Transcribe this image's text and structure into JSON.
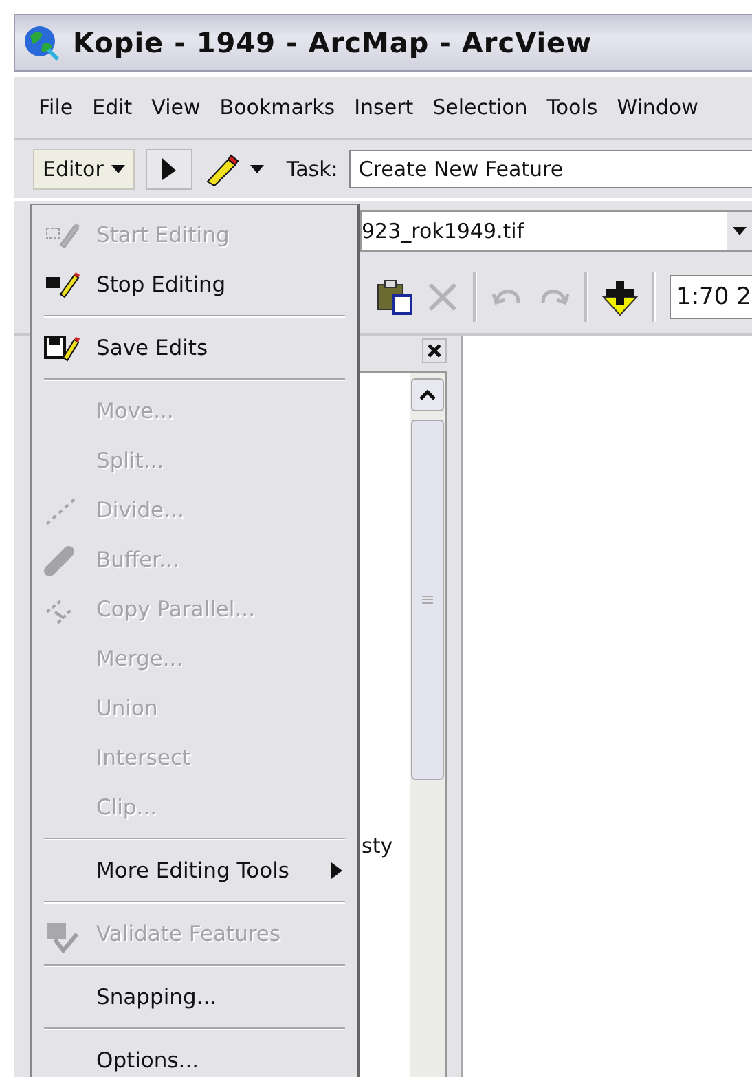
{
  "window": {
    "title": "Kopie - 1949 - ArcMap - ArcView"
  },
  "menu_bar": [
    "File",
    "Edit",
    "View",
    "Bookmarks",
    "Insert",
    "Selection",
    "Tools",
    "Window"
  ],
  "editor_toolbar": {
    "editor_label": "Editor",
    "task_label": "Task:",
    "task_value": "Create New Feature"
  },
  "layer_combo": {
    "value": "923_rok1949.tif"
  },
  "standard_toolbar": {
    "scale": "1:70 2"
  },
  "table_of_contents": {
    "visible_text": "sty"
  },
  "editor_menu": [
    {
      "kind": "item",
      "label": "Start Editing",
      "disabled": true
    },
    {
      "kind": "item",
      "label": "Stop Editing",
      "disabled": false
    },
    {
      "kind": "separator"
    },
    {
      "kind": "item",
      "label": "Save Edits",
      "disabled": false
    },
    {
      "kind": "separator"
    },
    {
      "kind": "item",
      "label": "Move...",
      "disabled": true
    },
    {
      "kind": "item",
      "label": "Split...",
      "disabled": true
    },
    {
      "kind": "item",
      "label": "Divide...",
      "disabled": true
    },
    {
      "kind": "item",
      "label": "Buffer...",
      "disabled": true
    },
    {
      "kind": "item",
      "label": "Copy Parallel...",
      "disabled": true
    },
    {
      "kind": "item",
      "label": "Merge...",
      "disabled": true
    },
    {
      "kind": "item",
      "label": "Union",
      "disabled": true
    },
    {
      "kind": "item",
      "label": "Intersect",
      "disabled": true
    },
    {
      "kind": "item",
      "label": "Clip...",
      "disabled": true
    },
    {
      "kind": "separator"
    },
    {
      "kind": "submenu",
      "label": "More Editing Tools",
      "disabled": false
    },
    {
      "kind": "separator"
    },
    {
      "kind": "item",
      "label": "Validate Features",
      "disabled": true
    },
    {
      "kind": "separator"
    },
    {
      "kind": "item",
      "label": "Snapping...",
      "disabled": false
    },
    {
      "kind": "separator"
    },
    {
      "kind": "item",
      "label": "Options...",
      "disabled": false
    }
  ]
}
